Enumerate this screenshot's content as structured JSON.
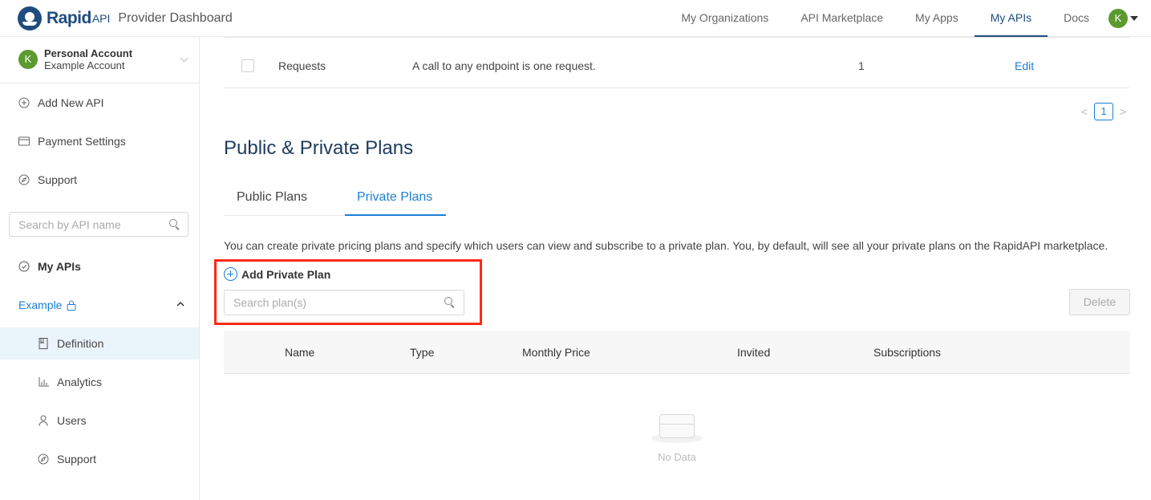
{
  "header": {
    "brand": "Rapid",
    "brand_suffix": "API",
    "subtitle": "Provider Dashboard",
    "nav": [
      "My Organizations",
      "API Marketplace",
      "My Apps",
      "My APIs",
      "Docs"
    ],
    "active_nav": "My APIs",
    "user_initial": "K"
  },
  "sidebar": {
    "account_initial": "K",
    "account_name": "Personal Account",
    "account_sub": "Example Account",
    "items": [
      "Add New API",
      "Payment Settings",
      "Support"
    ],
    "search_placeholder": "Search by API name",
    "my_apis_label": "My APIs",
    "api_name": "Example",
    "sub_items": [
      "Definition",
      "Analytics",
      "Users",
      "Support"
    ],
    "active_sub": "Definition"
  },
  "main": {
    "object_row": {
      "name": "Requests",
      "description": "A call to any endpoint is one request.",
      "value": "1",
      "action": "Edit"
    },
    "pagination": {
      "prev": "<",
      "page": "1",
      "next": ">"
    },
    "section_title": "Public & Private Plans",
    "tabs": [
      "Public Plans",
      "Private Plans"
    ],
    "active_tab": "Private Plans",
    "description": "You can create private pricing plans and specify which users can view and subscribe to a private plan. You, by default, will see all your private plans on the RapidAPI marketplace.",
    "add_plan_label": "Add Private Plan",
    "plan_search_placeholder": "Search plan(s)",
    "delete_label": "Delete",
    "table_columns": [
      "Name",
      "Type",
      "Monthly Price",
      "Invited",
      "Subscriptions"
    ],
    "empty_text": "No Data"
  },
  "colors": {
    "brand": "#1f4c7d",
    "accent": "#1c7ed6",
    "highlight": "#ff2a14",
    "avatar": "#5a9a2e"
  }
}
